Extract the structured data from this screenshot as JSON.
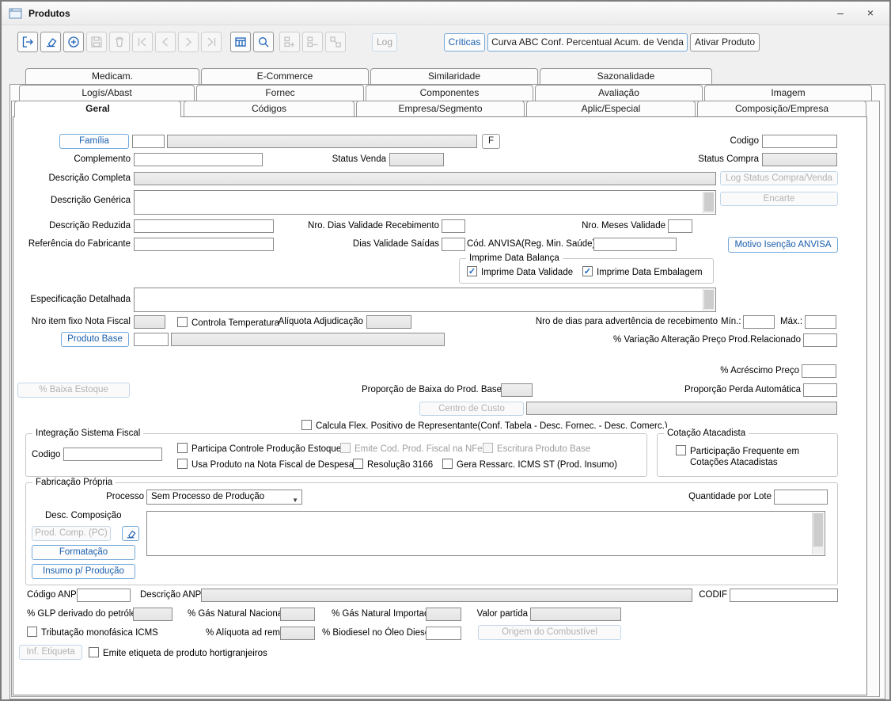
{
  "window": {
    "title": "Produtos"
  },
  "icons": {
    "minimize": "–",
    "close": "×",
    "check": "✓",
    "dropdown_arrow": "▼"
  },
  "toolbar": {
    "icon_names": [
      "exit-icon",
      "eraser-icon",
      "add-icon",
      "save-icon",
      "delete-icon",
      "nav-first-icon",
      "nav-prev-icon",
      "nav-next-icon",
      "nav-last-icon",
      "grid-icon",
      "search-icon",
      "group-add-icon",
      "group-remove-icon",
      "group-merge-icon"
    ],
    "log": "Log",
    "criticas": "Críticas",
    "curva_abc": "Curva ABC Conf. Percentual Acum. de Venda",
    "ativar_produto": "Ativar Produto"
  },
  "tabs": {
    "row1": [
      "Medicam.",
      "E-Commerce",
      "Similaridade",
      "Sazonalidade"
    ],
    "row2": [
      "Logís/Abast",
      "Fornec",
      "Componentes",
      "Avaliação",
      "Imagem"
    ],
    "row3": [
      "Geral",
      "Códigos",
      "Empresa/Segmento",
      "Aplic/Especial",
      "Composição/Empresa"
    ],
    "active": "Geral"
  },
  "form": {
    "familia_btn": "Família",
    "f_btn": "F",
    "codigo_label": "Codigo",
    "complemento_label": "Complemento",
    "status_venda_label": "Status Venda",
    "status_compra_label": "Status Compra",
    "descricao_completa_label": "Descrição Completa",
    "log_status_btn": "Log Status Compra/Venda",
    "descricao_generica_label": "Descrição Genérica",
    "encarte_btn": "Encarte",
    "descricao_reduzida_label": "Descrição Reduzida",
    "nro_dias_validade_recebimento_label": "Nro. Dias Validade Recebimento",
    "nro_meses_validade_label": "Nro. Meses Validade",
    "referencia_fabricante_label": "Referência do Fabricante",
    "dias_validade_saidas_label": "Dias Validade Saídas",
    "cod_anvisa_label": "Cód. ANVISA(Reg. Min. Saúde)",
    "motivo_isencao_btn": "Motivo Isenção ANVISA",
    "imprime_data_balanca_legend": "Imprime Data Balança",
    "imprime_data_validade_cb": "Imprime Data Validade",
    "imprime_data_embalagem_cb": "Imprime Data Embalagem",
    "especificacao_detalhada_label": "Especificação Detalhada",
    "nro_item_fixo_label": "Nro item fixo Nota Fiscal",
    "controla_temperatura_cb": "Controla Temperatura",
    "aliquota_adjudicacao_label": "Alíquota Adjudicação",
    "advertencia_label": "Nro de dias para advertência de recebimento",
    "min_label": "Mín.:",
    "max_label": "Máx.:",
    "variacao_preco_label": "% Variação Alteração Preço Prod.Relacionado",
    "produto_base_btn": "Produto Base",
    "acrescimo_preco_label": "% Acréscimo Preço",
    "baixa_estoque_btn": "% Baixa Estoque",
    "proporcao_baixa_label": "Proporção de Baixa do Prod. Base",
    "proporcao_perda_label": "Proporção Perda Automática",
    "centro_custo_btn": "Centro de Custo",
    "calcula_flex_cb": "Calcula Flex. Positivo de Representante(Conf. Tabela - Desc. Fornec. - Desc. Comerc.)",
    "integracao_fiscal_legend": "Integração Sistema Fiscal",
    "fiscal_codigo_label": "Codigo",
    "participa_controle_cb": "Participa Controle Produção Estoque",
    "emite_cod_cb": "Emite Cod. Prod. Fiscal na NFe",
    "escritura_cb": "Escritura Produto Base",
    "usa_produto_cb": "Usa Produto na Nota Fiscal de Despesa",
    "resolucao_cb": "Resolução 3166",
    "gera_ressarc_cb": "Gera Ressarc. ICMS ST (Prod. Insumo)",
    "cotacao_legend": "Cotação Atacadista",
    "participacao_frequente_cb": "Participação Frequente em Cotações Atacadistas",
    "fabricacao_legend": "Fabricação Própria",
    "processo_label": "Processo",
    "processo_value": "Sem Processo de Produção",
    "quantidade_lote_label": "Quantidade por Lote",
    "desc_composicao_label": "Desc. Composição",
    "prod_comp_btn": "Prod. Comp. (PC)",
    "formatacao_btn": "Formatação",
    "insumo_btn": "Insumo p/ Produção",
    "codigo_anp_label": "Código ANP",
    "descricao_anp_label": "Descrição ANP",
    "codif_label": "CODIF",
    "glp_label": "% GLP derivado do petróleo",
    "gas_nacional_label": "% Gás Natural Nacional",
    "gas_importado_label": "% Gás Natural Importado",
    "valor_partida_label": "Valor partida",
    "tributacao_cb": "Tributação monofásica ICMS",
    "aliquota_ad_rem_label": "% Alíquota ad rem",
    "biodiesel_label": "% Biodiesel no Óleo Diesel",
    "origem_combustivel_btn": "Origem do Combustível",
    "inf_etiqueta_btn": "Inf. Etiqueta",
    "emite_etiqueta_cb": "Emite etiqueta de produto hortigranjeiros"
  },
  "colors": {
    "accent_blue": "#1b5fae",
    "button_border_blue": "#74a9da",
    "check_blue": "#1464c0",
    "window_bg": "#f0f0f0",
    "disabled_text": "#b3b3b3"
  }
}
